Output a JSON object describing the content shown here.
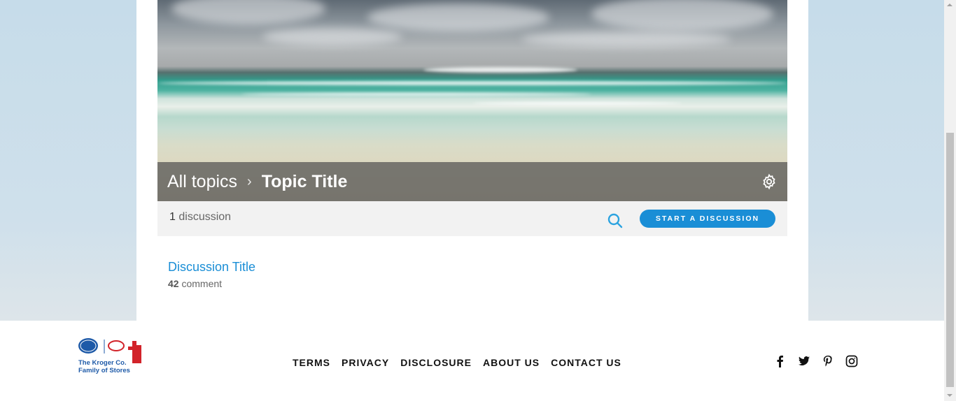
{
  "breadcrumb": {
    "all_topics": "All topics",
    "separator": "›",
    "current": "Topic Title"
  },
  "info_bar": {
    "count": "1",
    "count_label": "discussion",
    "start_button": "START A DISCUSSION"
  },
  "discussion": {
    "title": "Discussion Title",
    "comment_count": "42",
    "comment_label": "comment"
  },
  "footer": {
    "logo_text_line1": "The Kroger Co.",
    "logo_text_line2": "Family of Stores",
    "nav": [
      "TERMS",
      "PRIVACY",
      "DISCLOSURE",
      "ABOUT US",
      "CONTACT US"
    ],
    "social_icons": [
      "facebook-icon",
      "twitter-icon",
      "pinterest-icon",
      "instagram-icon"
    ]
  },
  "colors": {
    "accent": "#1a8ed6",
    "page_background": "#c6dcea",
    "info_bar": "#f2f2f2"
  }
}
